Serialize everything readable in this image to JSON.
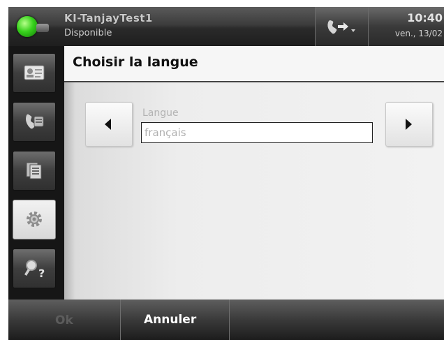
{
  "header": {
    "user_name": "KI-TanjayTest1",
    "status": "Disponible",
    "time": "10:40",
    "date": "ven., 13/02",
    "presence_color": "#37d11c"
  },
  "sidebar": {
    "items": [
      {
        "icon": "contact-card-icon",
        "active": false
      },
      {
        "icon": "phone-log-icon",
        "active": false
      },
      {
        "icon": "documents-icon",
        "active": false
      },
      {
        "icon": "settings-gear-icon",
        "active": true
      },
      {
        "icon": "search-help-icon",
        "active": false
      }
    ]
  },
  "main": {
    "title": "Choisir la langue",
    "language_label": "Langue",
    "language_value": "français"
  },
  "toolbar": {
    "ok_label": "Ok",
    "cancel_label": "Annuler"
  }
}
